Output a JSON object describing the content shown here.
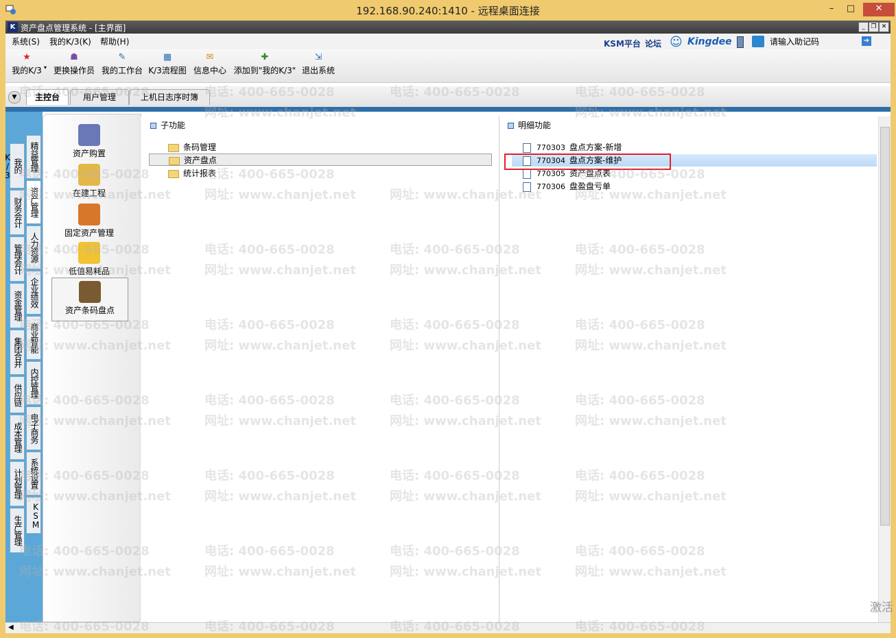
{
  "rdp": {
    "title": "192.168.90.240:1410 - 远程桌面连接",
    "min": "–",
    "max": "□",
    "close": "✕"
  },
  "app": {
    "title": "资产盘点管理系统 - [主界面]",
    "logo": "K",
    "menu": [
      "系统(S)",
      "我的K/3(K)",
      "帮助(H)"
    ],
    "brand": {
      "ksm": "KSM平台",
      "forum": "论坛",
      "kingdee": "Kingdee",
      "assist": "请输入助记码"
    }
  },
  "toolbar": [
    {
      "label": "我的K/3",
      "icon": "star-icon"
    },
    {
      "label": "更换操作员",
      "icon": "users-icon"
    },
    {
      "label": "我的工作台",
      "icon": "desk-icon"
    },
    {
      "label": "K/3流程图",
      "icon": "flow-icon"
    },
    {
      "label": "信息中心",
      "icon": "message-icon"
    },
    {
      "label": "添加到\"我的K/3\"",
      "icon": "add-icon"
    },
    {
      "label": "退出系统",
      "icon": "exit-icon"
    }
  ],
  "tabs": [
    "主控台",
    "用户管理",
    "上机日志序时簿"
  ],
  "left_nav": {
    "outer": [
      "我的K/3",
      "财务会计",
      "管理会计",
      "资金管理",
      "集团合并",
      "供应链",
      "成本管理",
      "计划管理",
      "生产管理"
    ],
    "inner": [
      "精益管理",
      "资产管理",
      "人力资源",
      "企业绩效",
      "商业智能",
      "内控管理",
      "电子商务",
      "系统设置",
      "KSM"
    ]
  },
  "modules": [
    "资产购置",
    "在建工程",
    "固定资产管理",
    "低值易耗品",
    "资产条码盘点"
  ],
  "sub_pane": {
    "header": "子功能",
    "items": [
      "条码管理",
      "资产盘点",
      "统计报表"
    ]
  },
  "detail_pane": {
    "header": "明细功能",
    "items": [
      {
        "code": "770303",
        "name": "盘点方案-新增"
      },
      {
        "code": "770304",
        "name": "盘点方案-维护"
      },
      {
        "code": "770305",
        "name": "资产盘点表"
      },
      {
        "code": "770306",
        "name": "盘盈盘亏单"
      }
    ]
  },
  "watermark": {
    "phone": "电话: 400-665-0028",
    "site": "网址: www.chanjet.net"
  },
  "activate": "激活",
  "colors": {
    "rdp_bar": "#f0ca6e",
    "highlight": "#e0202a",
    "nav_blue": "#5aa7d8"
  }
}
